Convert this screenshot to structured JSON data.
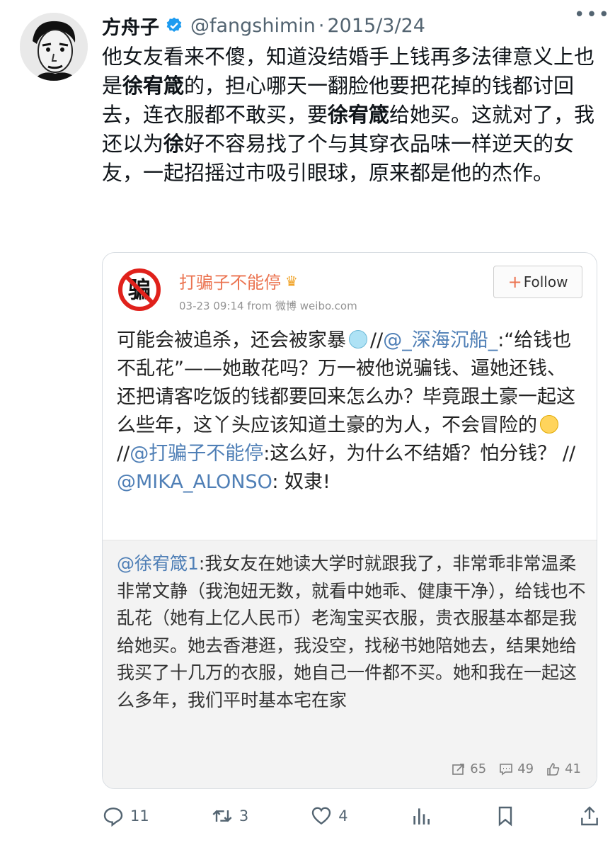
{
  "tweet": {
    "author_name": "方舟子",
    "handle": "@fangshimin",
    "separator": "·",
    "date": "2015/3/24",
    "text_segments": [
      {
        "t": "他女友看来不傻，知道没结婚手上钱再多法律意义上也是",
        "b": false
      },
      {
        "t": "徐宥箴",
        "b": true
      },
      {
        "t": "的，担心哪天一翻脸他要把花掉的钱都讨回去，连衣服都不敢买，要",
        "b": false
      },
      {
        "t": "徐宥箴",
        "b": true
      },
      {
        "t": "给她买。这就对了，我还以为",
        "b": false
      },
      {
        "t": "徐",
        "b": true
      },
      {
        "t": "好不容易找了个与其穿衣品味一样逆天的女友，一起招摇过市吸引眼球，原来都是他的杰作。",
        "b": false
      }
    ]
  },
  "weibo": {
    "avatar_char": "骗",
    "username": "打骗子不能停",
    "crown": "♛",
    "meta": "03-23 09:14  from  微博 weibo.com",
    "follow_plus": "+",
    "follow_label": "Follow",
    "text": {
      "s1": "可能会被追杀，还会被家暴",
      "s2": "//",
      "s3": "@_深海沉船_",
      "s4": ":“给钱也不乱花”——她敢花吗？万一被他说骗钱、逼她还钱、还把请客吃饭的钱都要回来怎么办？毕竟跟土豪一起这么些年，这丫头应该知道土豪的为人，不会冒险的",
      "s5": " //",
      "s6": "@打骗子不能停",
      "s7": ":这么好，为什么不结婚？怕分钱？ //",
      "s8": "@MIKA_ALONSO",
      "s9": ": 奴隶!"
    },
    "quoted": {
      "mention": "@徐宥箴1",
      "text": ":我女友在她读大学时就跟我了，非常乖非常温柔非常文静（我泡妞无数，就看中她乖、健康干净），给钱也不乱花（她有上亿人民币）老淘宝买衣服，贵衣服基本都是我给她买。她去香港逛，我没空，找秘书她陪她去，结果她给我买了十几万的衣服，她自己一件都不买。她和我在一起这么多年，我们平时基本宅在家"
    },
    "stats": {
      "reposts": "65",
      "comments": "49",
      "likes": "41"
    }
  },
  "actions": {
    "replies": "11",
    "retweets": "3",
    "likes": "4"
  },
  "colors": {
    "weibo_orange": "#eb7350",
    "link_blue": "#4f7fb6",
    "verified_blue": "#1d9bf0",
    "muted": "#536471"
  }
}
